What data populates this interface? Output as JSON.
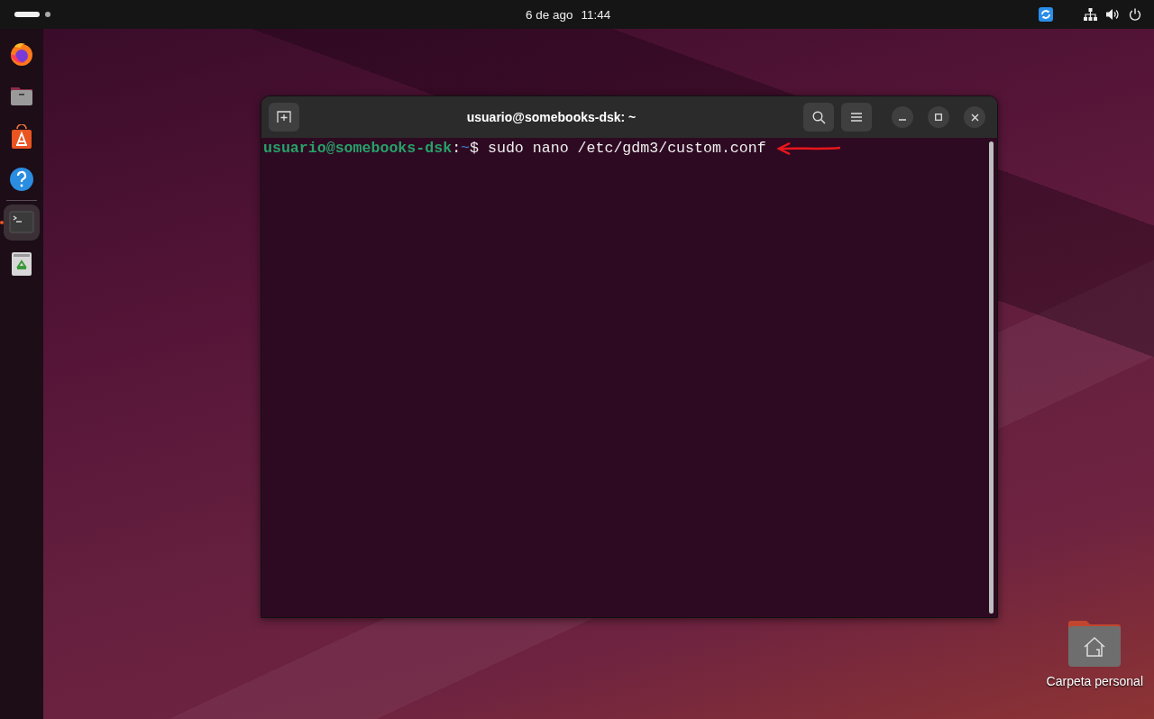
{
  "top_bar": {
    "workspaces": [
      {
        "selected": true
      },
      {
        "selected": false
      }
    ],
    "date": "6 de ago",
    "time": "11:44"
  },
  "dock": {
    "apps": [
      {
        "kind": "firefox",
        "running": false
      },
      {
        "kind": "files",
        "running": false
      },
      {
        "kind": "appcenter",
        "running": false
      },
      {
        "kind": "help",
        "running": false
      },
      {
        "kind": "terminal",
        "running": true
      },
      {
        "kind": "trash",
        "running": false
      }
    ]
  },
  "window": {
    "title": "usuario@somebooks-dsk: ~",
    "lines": [
      {
        "user_host": "usuario@somebooks-dsk",
        "separator": ":",
        "path": "~",
        "prompt": "$",
        "command": "sudo nano /etc/gdm3/custom.conf",
        "arrow": true
      }
    ]
  },
  "desktop_icons": [
    {
      "label": "Carpeta personal"
    }
  ]
}
